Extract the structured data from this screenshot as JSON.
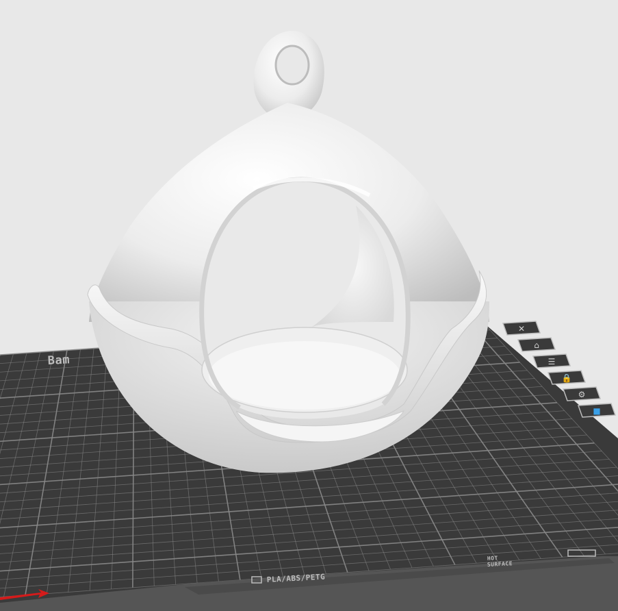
{
  "viewport": {
    "background": "#e8e8e8"
  },
  "build_plate": {
    "surface_color": "#3a3a3a",
    "grid_color": "#8a8a8a",
    "brand_text": "Bam",
    "material_label": "PLA/ABS/PETG",
    "surface_label_top": "HOT",
    "surface_label_bottom": "SURFACE"
  },
  "model": {
    "name": "hanging-bird-feeder",
    "color": "#f2f2f2"
  },
  "object_toolbar": {
    "items": [
      {
        "name": "delete-object-icon",
        "glyph": "✕"
      },
      {
        "name": "camera-view-icon",
        "glyph": "⌂"
      },
      {
        "name": "object-list-icon",
        "glyph": "☰"
      },
      {
        "name": "lock-object-icon",
        "glyph": "🔒"
      },
      {
        "name": "settings-object-icon",
        "glyph": "⚙"
      },
      {
        "name": "color-object-icon",
        "glyph": "■"
      }
    ]
  },
  "axis": {
    "x_color": "#d41b1b"
  }
}
